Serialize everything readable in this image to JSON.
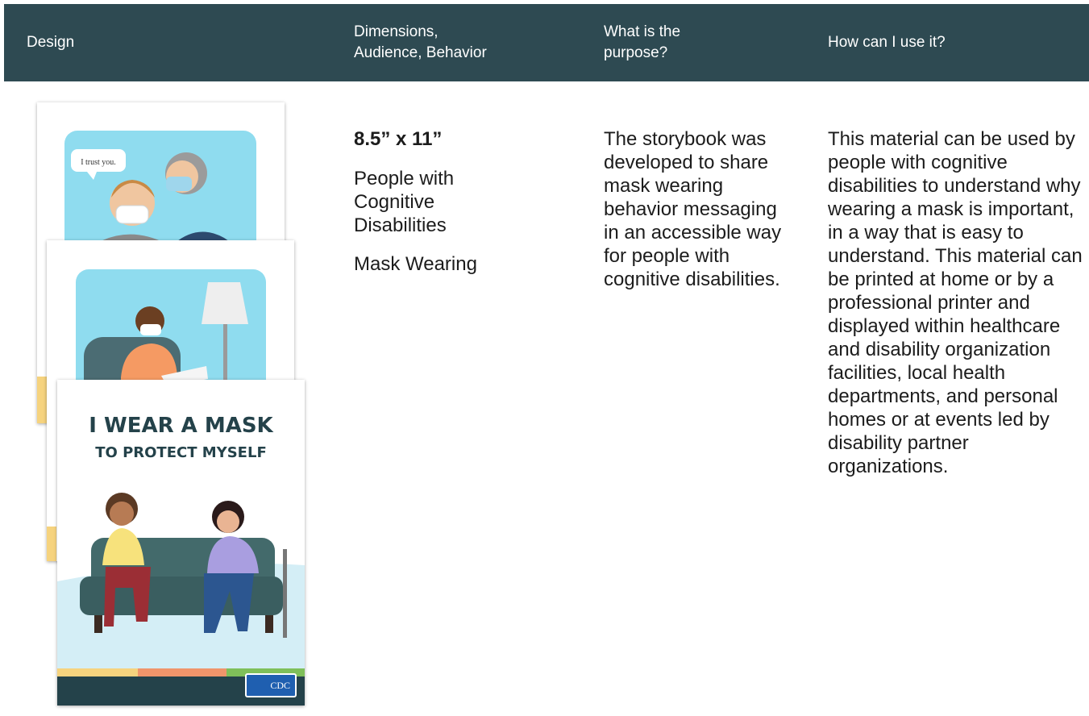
{
  "header": {
    "design": "Design",
    "dimensions": [
      "Dimensions,",
      "Audience, Behavior"
    ],
    "purpose": [
      "What is the",
      "purpose?"
    ],
    "how_use": "How can I use it?"
  },
  "row": {
    "dimensions_size": "8.5” x 11”",
    "audience": "People with Cognitive Disabilities",
    "behavior": "Mask Wearing",
    "purpose_text": "The storybook was developed to share mask wearing behavior messaging in an accessible way for people with cognitive disabilities.",
    "how_use_text": "This material can be used by people with cognitive disabilities to understand why wearing a mask is important, in a way that is easy to understand. This material can be printed at home or by a professional printer and displayed within healthcare and disability organization facilities, local health departments, and personal homes or at events led by disability partner organizations."
  },
  "design_images": {
    "page1_speech": "I trust you.",
    "cover_title_line1": "I WEAR A MASK",
    "cover_title_line2": "TO PROTECT MYSELF",
    "logo_text": "CDC"
  },
  "colors": {
    "header_bg": "#2e4a52",
    "header_text": "#ffffff",
    "sky_blue": "#8fdcef",
    "cover_title": "#24424a",
    "sofa_green": "#436a6b"
  },
  "icons": [
    "cdc-logo-icon"
  ]
}
